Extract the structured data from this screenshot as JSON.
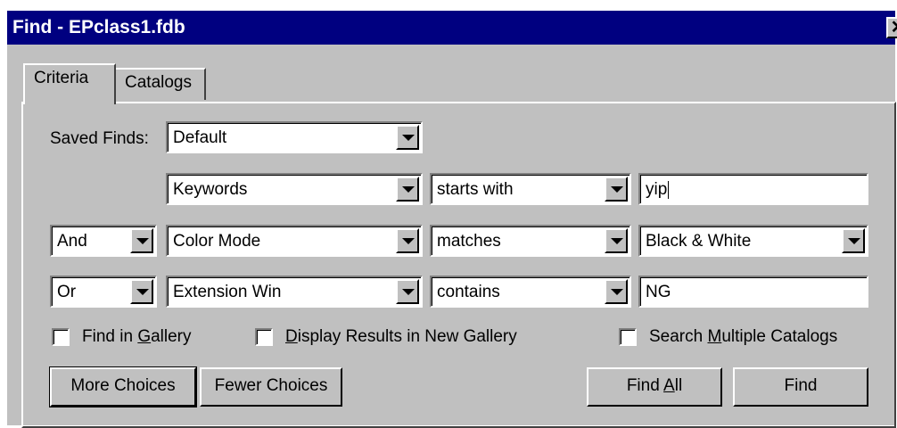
{
  "window": {
    "title": "Find - EPclass1.fdb",
    "close_glyph": "✕"
  },
  "tabs": [
    {
      "label": "Criteria",
      "active": true
    },
    {
      "label": "Catalogs",
      "active": false
    }
  ],
  "saved_finds": {
    "label": "Saved Finds:",
    "value": "Default"
  },
  "rows": [
    {
      "conjunction": null,
      "field": "Keywords",
      "operator": "starts with",
      "value": "yip",
      "value_is_dropdown": false
    },
    {
      "conjunction": "And",
      "field": "Color Mode",
      "operator": "matches",
      "value": "Black & White",
      "value_is_dropdown": true
    },
    {
      "conjunction": "Or",
      "field": "Extension Win",
      "operator": "contains",
      "value": "NG",
      "value_is_dropdown": false
    }
  ],
  "options": {
    "find_in_gallery": {
      "pre": "Find in ",
      "ul": "G",
      "post": "allery",
      "checked": false
    },
    "display_new_gallery": {
      "pre": "",
      "ul": "D",
      "post": "isplay Results in New Gallery",
      "checked": false
    },
    "search_multiple": {
      "pre": "Search ",
      "ul": "M",
      "post": "ultiple Catalogs",
      "checked": false
    }
  },
  "buttons": {
    "more_choices": "More Choices",
    "fewer_choices": "Fewer Choices",
    "find_all": {
      "pre": "Find ",
      "ul": "A",
      "post": "ll"
    },
    "find": "Find"
  }
}
